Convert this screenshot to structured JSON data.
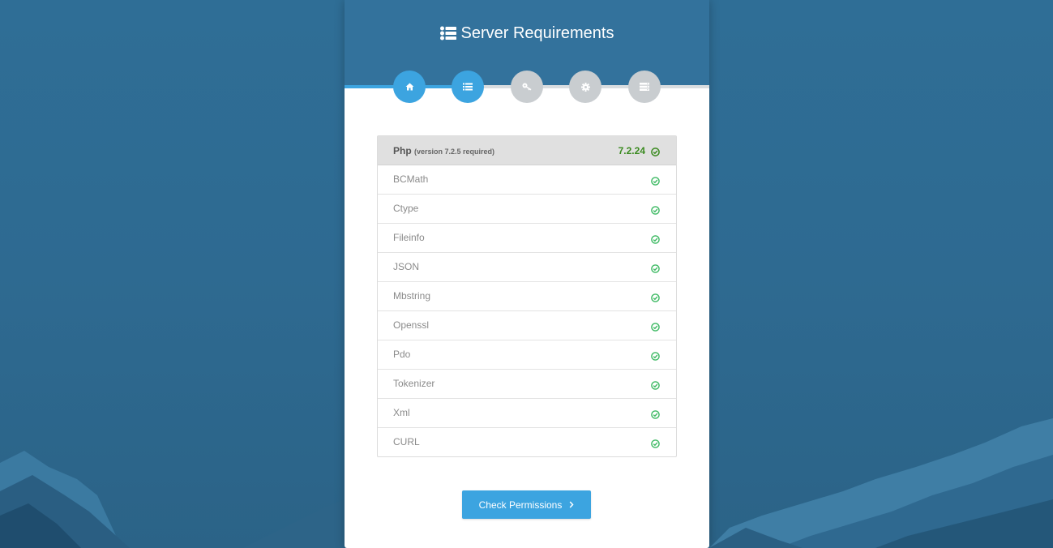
{
  "page": {
    "title": "Server Requirements",
    "title_icon": "list-icon"
  },
  "steps": [
    {
      "name": "home",
      "icon": "home-icon",
      "active": true
    },
    {
      "name": "requirements",
      "icon": "list-icon",
      "active": true
    },
    {
      "name": "permissions",
      "icon": "key-icon",
      "active": false
    },
    {
      "name": "environment",
      "icon": "gear-icon",
      "active": false
    },
    {
      "name": "final",
      "icon": "server-icon",
      "active": false
    }
  ],
  "php": {
    "label": "Php",
    "required": "(version 7.2.5 required)",
    "version": "7.2.24",
    "status_icon": "check-circle-icon"
  },
  "requirements": [
    {
      "label": "BCMath"
    },
    {
      "label": "Ctype"
    },
    {
      "label": "Fileinfo"
    },
    {
      "label": "JSON"
    },
    {
      "label": "Mbstring"
    },
    {
      "label": "Openssl"
    },
    {
      "label": "Pdo"
    },
    {
      "label": "Tokenizer"
    },
    {
      "label": "Xml"
    },
    {
      "label": "CURL"
    }
  ],
  "button": {
    "label": "Check Permissions",
    "icon": "chevron-right-icon"
  },
  "colors": {
    "accent": "#3ca4e0",
    "header": "#33729c",
    "success": "#3cb962",
    "version": "#3a8a1f",
    "inactive_step": "#c9cdd0"
  }
}
